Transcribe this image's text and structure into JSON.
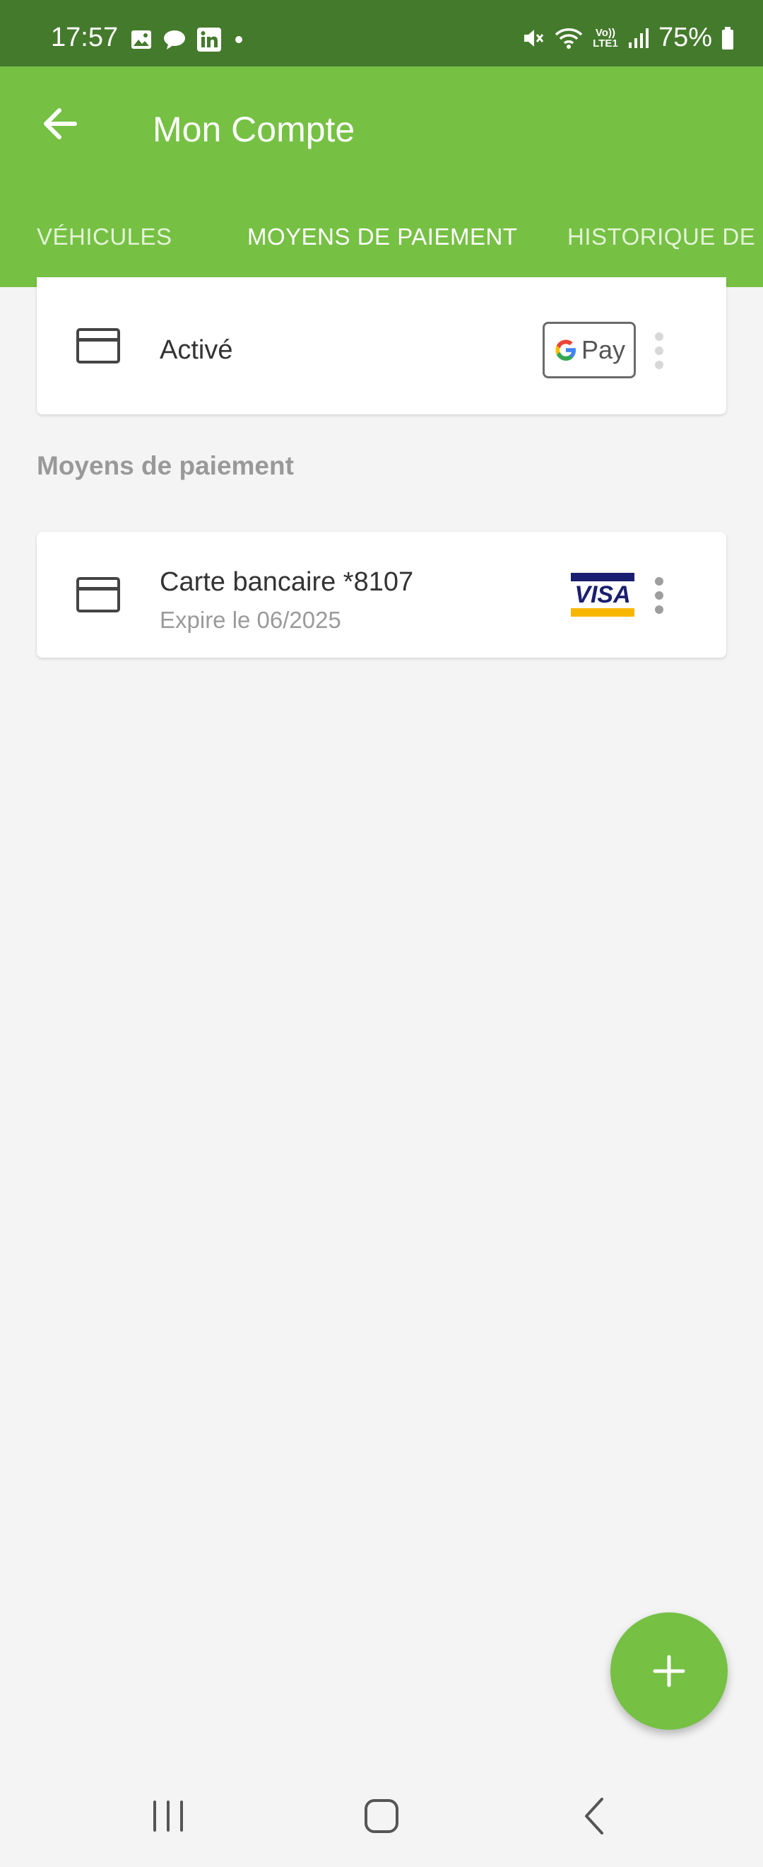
{
  "status_bar": {
    "time": "17:57",
    "battery": "75%",
    "network_label": "Vo)) LTE1",
    "left_icons": [
      "gallery-icon",
      "chat-icon",
      "linkedin-icon",
      "dot-icon"
    ],
    "right_icons": [
      "mute-icon",
      "wifi-icon",
      "signal-icon",
      "battery-icon"
    ]
  },
  "app_bar": {
    "title": "Mon Compte",
    "back_icon": "arrow-left-icon"
  },
  "tabs": [
    {
      "label": "VÉHICULES",
      "active": false
    },
    {
      "label": "MOYENS DE PAIEMENT",
      "active": true
    },
    {
      "label": "HISTORIQUE DE S",
      "active": false
    }
  ],
  "gpay_card": {
    "status": "Activé",
    "badge_g": "G",
    "badge_pay": "Pay"
  },
  "section": {
    "title": "Moyens de paiement"
  },
  "cards": [
    {
      "title": "Carte bancaire *8107",
      "expiry": "Expire le 06/2025",
      "brand": "VISA"
    }
  ],
  "fab": {
    "icon": "plus-icon"
  },
  "nav": {
    "icons": [
      "recents-icon",
      "home-icon",
      "back-icon"
    ]
  },
  "colors": {
    "status_bar": "#447a2c",
    "primary": "#76c044",
    "background": "#f4f4f4",
    "visa_blue": "#1a1f71",
    "visa_gold": "#f7b600"
  }
}
